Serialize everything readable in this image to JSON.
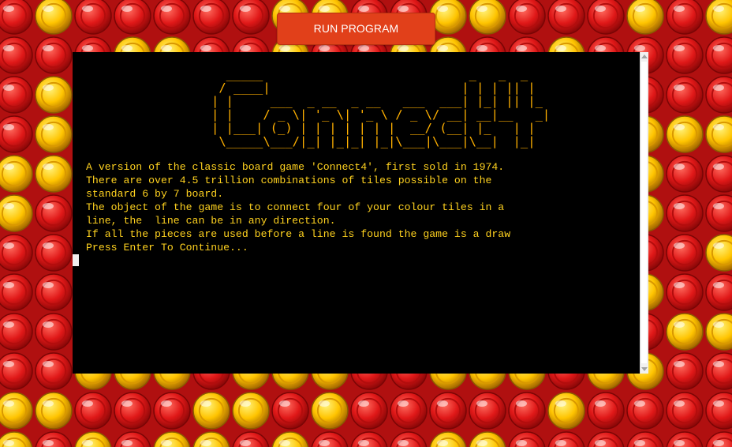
{
  "colors": {
    "red_counter": "#e01818",
    "yellow_counter": "#ffc400",
    "button": "#e1401a",
    "terminal_bg": "#000000",
    "terminal_text": "#ffd21f",
    "banner_text": "#ffb000"
  },
  "toolbar": {
    "run_label": "RUN PROGRAM"
  },
  "terminal": {
    "banner_lines": [
      "  _____                            _   _  _   ",
      " / ____|                          | | | || |  ",
      "| |     ___  _ __  _ __   ___  ___| |_| || |_ ",
      "| |    / _ \\| '_ \\| '_ \\ / _ \\/ __| __|__   _|",
      "| |___| (_) | | | | | | |  __/ (__| |_   | |  ",
      " \\_____\\___/|_| |_|_| |_|\\___|\\___|\\__|  |_|  "
    ],
    "intro_lines": [
      "A version of the classic board game 'Connect4', first sold in 1974.",
      "There are over 4.5 trillion combinations of tiles possible on the",
      "standard 6 by 7 board.",
      "The object of the game is to connect four of your colour tiles in a",
      "line, the  line can be in any direction.",
      "If all the pieces are used before a line is found the game is a draw",
      "Press Enter To Continue..."
    ]
  }
}
